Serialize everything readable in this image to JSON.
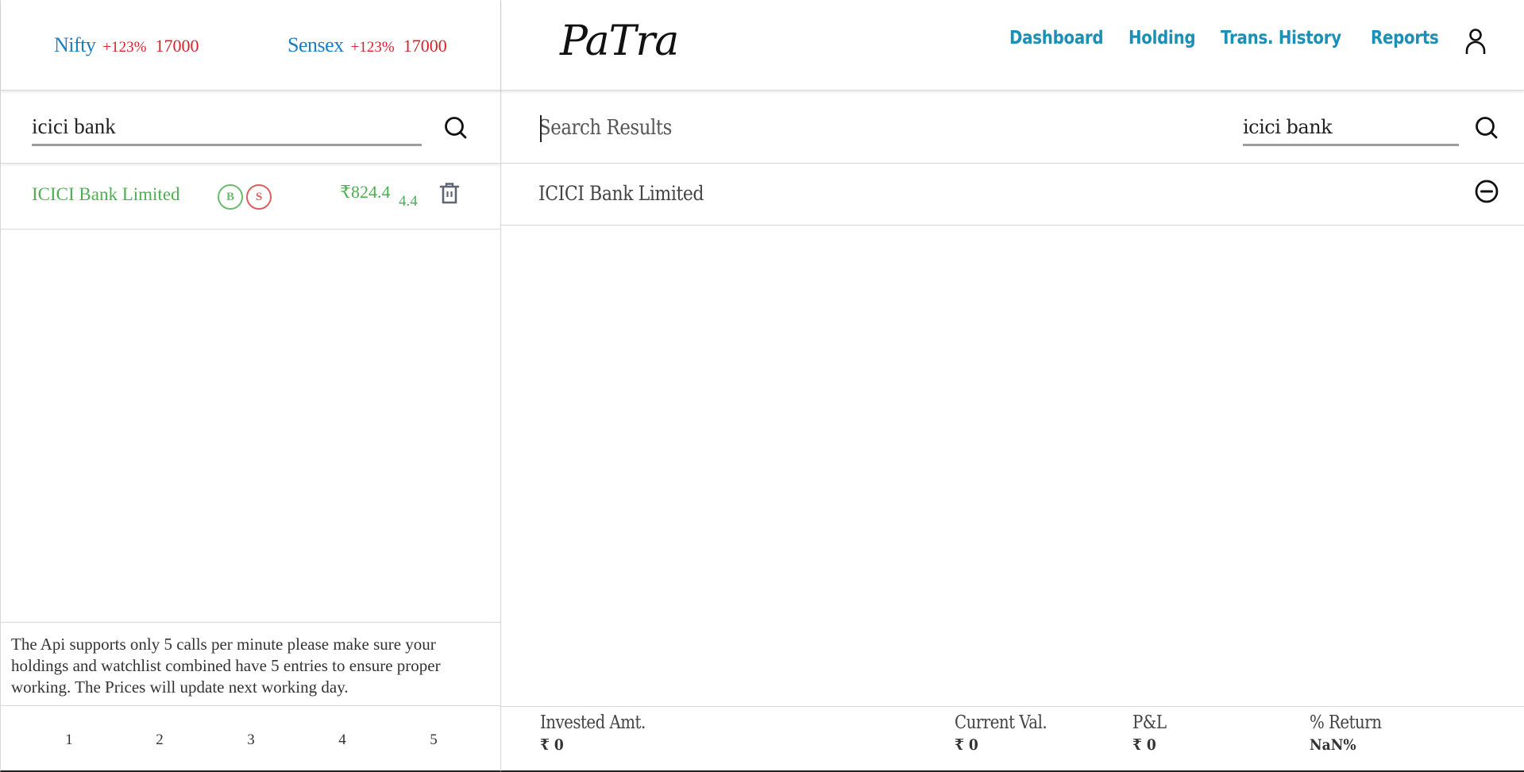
{
  "ticker": {
    "items": [
      {
        "name": "Nifty",
        "change": "+123%",
        "value": "17000"
      },
      {
        "name": "Sensex",
        "change": "+123%",
        "value": "17000"
      }
    ]
  },
  "watchlist": {
    "search": {
      "value": "icici bank",
      "icon": "search-icon"
    },
    "items": [
      {
        "name": "ICICI Bank Limited",
        "buy_label": "B",
        "sell_label": "S",
        "price": "₹824.4",
        "change": "4.4",
        "delete_icon": "trash-icon"
      }
    ],
    "notice": "The Api supports only 5 calls per minute please make sure your holdings and watchlist combined have 5 entries to ensure proper working. The Prices will update next working day.",
    "pages": [
      "1",
      "2",
      "3",
      "4",
      "5"
    ]
  },
  "header": {
    "logo": "PaTra",
    "nav": [
      {
        "label": "Dashboard"
      },
      {
        "label": "Holding"
      },
      {
        "label": "Trans. History"
      },
      {
        "label": "Reports"
      }
    ],
    "user_icon": "user-icon"
  },
  "results": {
    "title": "Search Results",
    "search": {
      "value": "icici bank",
      "icon": "search-icon"
    },
    "items": [
      {
        "name": "ICICI Bank Limited",
        "action_icon": "minus-circle-icon"
      }
    ]
  },
  "summary": {
    "invested": {
      "label": "Invested Amt.",
      "value": "₹  0"
    },
    "current": {
      "label": "Current Val.",
      "value": "₹  0"
    },
    "pnl": {
      "label": "P&L",
      "value": "₹  0"
    },
    "return": {
      "label": "% Return",
      "value": "NaN%"
    }
  },
  "colors": {
    "index_name": "#1a7fc1",
    "index_value": "#d3232b",
    "nav_link": "#1b8fb5",
    "positive": "#4caf50",
    "buy": "#6dbb6f",
    "sell": "#de5d5d"
  }
}
